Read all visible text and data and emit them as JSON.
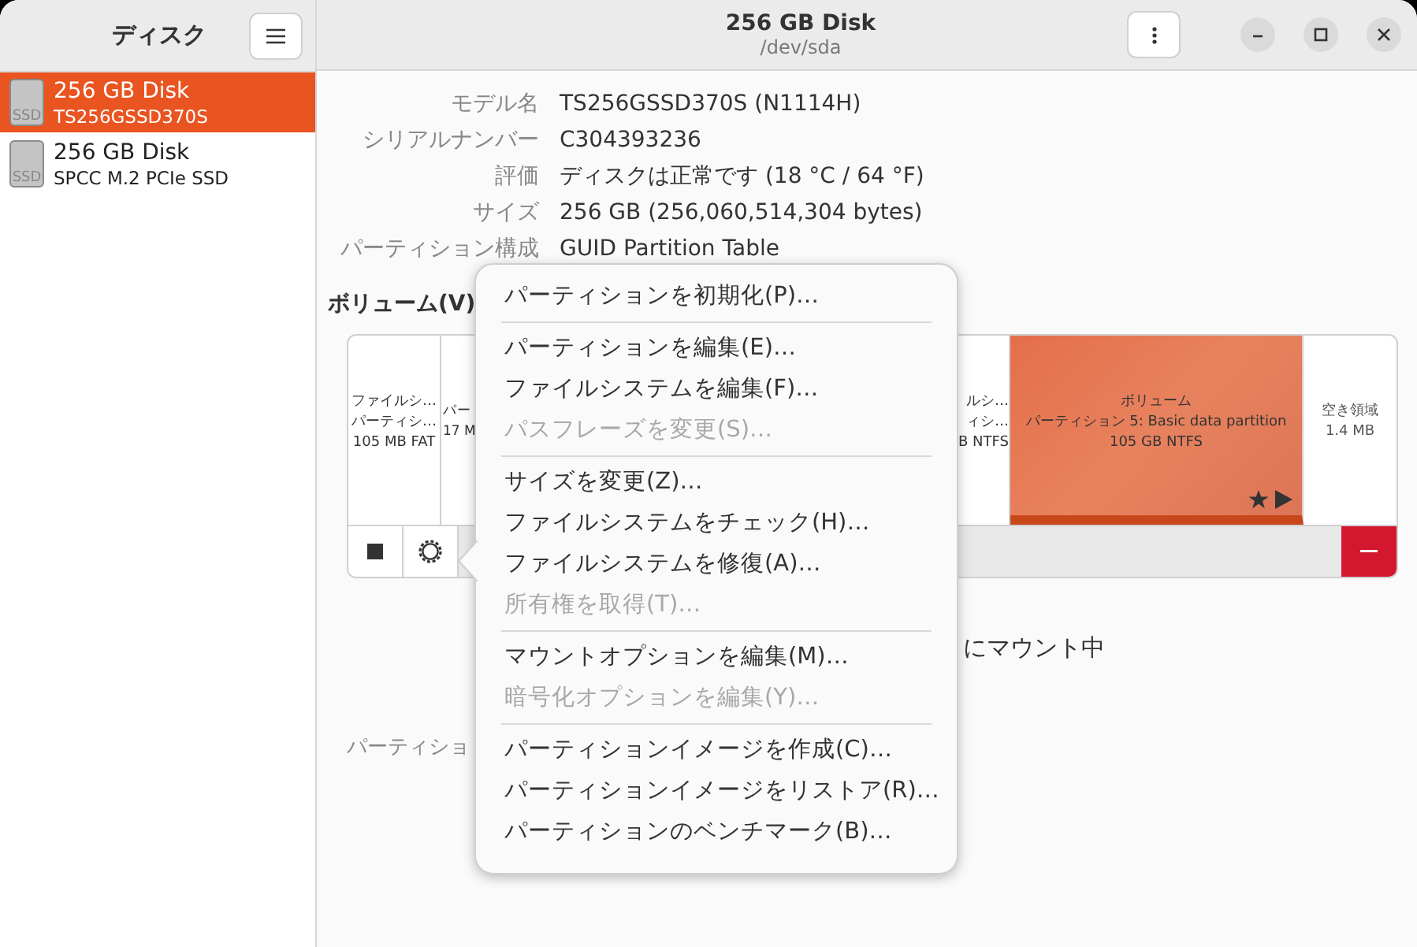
{
  "sidebar": {
    "title": "ディスク",
    "disks": [
      {
        "name": "256 GB Disk",
        "model": "TS256GSSD370S",
        "icon_label": "SSD",
        "selected": true
      },
      {
        "name": "256 GB Disk",
        "model": "SPCC M.2 PCIe SSD",
        "icon_label": "SSD",
        "selected": false
      }
    ]
  },
  "header": {
    "title": "256 GB Disk",
    "subtitle": "/dev/sda"
  },
  "info": [
    {
      "label": "モデル名",
      "value": "TS256GSSD370S (N1114H)"
    },
    {
      "label": "シリアルナンバー",
      "value": "C304393236"
    },
    {
      "label": "評価",
      "value": "ディスクは正常です (18 °C / 64 °F)"
    },
    {
      "label": "サイズ",
      "value": "256 GB (256,060,514,304 bytes)"
    },
    {
      "label": "パーティション構成",
      "value": "GUID Partition Table"
    }
  ],
  "volumes_heading": "ボリューム(V)",
  "segments": [
    {
      "kind": "partition",
      "lines": [
        "ファイルシ…",
        "パーティシ…",
        "105 MB FAT"
      ],
      "selected": false
    },
    {
      "kind": "partition",
      "lines": [
        "パー",
        "17 M"
      ],
      "selected": false
    },
    {
      "kind": "partition",
      "lines": [
        "ルシ…",
        "ィシ…",
        "B NTFS"
      ],
      "selected": false
    },
    {
      "kind": "partition",
      "lines": [
        "ボリューム",
        "パーティション 5: Basic data partition",
        "105 GB NTFS"
      ],
      "selected": true
    },
    {
      "kind": "free",
      "lines": [
        "空き領域",
        "1.4 MB"
      ],
      "selected": false
    }
  ],
  "details": {
    "mount_text": "にマウント中",
    "partition_label": "パーティショ"
  },
  "menu": [
    [
      {
        "label": "パーティションを初期化(P)…",
        "disabled": false
      }
    ],
    [
      {
        "label": "パーティションを編集(E)…",
        "disabled": false
      },
      {
        "label": "ファイルシステムを編集(F)…",
        "disabled": false
      },
      {
        "label": "パスフレーズを変更(S)…",
        "disabled": true
      }
    ],
    [
      {
        "label": "サイズを変更(Z)…",
        "disabled": false
      },
      {
        "label": "ファイルシステムをチェック(H)…",
        "disabled": false
      },
      {
        "label": "ファイルシステムを修復(A)…",
        "disabled": false
      },
      {
        "label": "所有権を取得(T)…",
        "disabled": true
      }
    ],
    [
      {
        "label": "マウントオプションを編集(M)…",
        "disabled": false
      },
      {
        "label": "暗号化オプションを編集(Y)…",
        "disabled": true
      }
    ],
    [
      {
        "label": "パーティションイメージを作成(C)…",
        "disabled": false
      },
      {
        "label": "パーティションイメージをリストア(R)…",
        "disabled": false
      },
      {
        "label": "パーティションのベンチマーク(B)…",
        "disabled": false
      }
    ]
  ]
}
